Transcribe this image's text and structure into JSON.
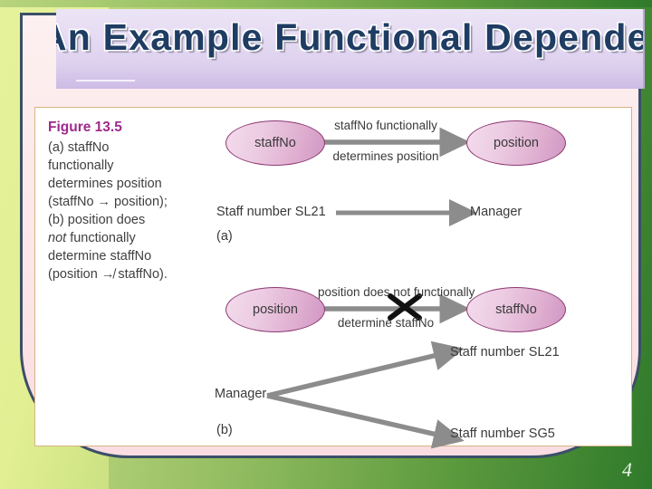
{
  "slide": {
    "title": "An Example Functional Dependency",
    "page_number": "4",
    "accent_title_color": "#1f3c63",
    "figure_title_color": "#9e2a8c",
    "arrow_color": "#8c8c8c",
    "ellipse_border_color": "#8e3a74",
    "figure_border_color": "#d8b383",
    "background_green": "#2f7a2b",
    "left_wash_color": "#e6f29a"
  },
  "figure": {
    "caption": {
      "title": "Figure 13.5",
      "lines": [
        "(a) staffNo",
        "functionally",
        "determines position",
        "(staffNo → position);",
        "(b) position does",
        "not functionally",
        "determine staffNo",
        "(position ↛ staffNo)."
      ],
      "italic_line_index": 5,
      "italic_word": "not"
    },
    "part_a": {
      "label": "(a)",
      "source_node": "staffNo",
      "target_node": "position",
      "arrow_caption_top": "staffNo functionally",
      "arrow_caption_bottom": "determines position",
      "instance_source": "Staff number SL21",
      "instance_target": "Manager"
    },
    "part_b": {
      "label": "(b)",
      "source_node": "position",
      "target_node": "staffNo",
      "arrow_caption_top": "position does not functionally",
      "arrow_caption_bottom": "determine staffNo",
      "negation_mark": "✕",
      "instance_source": "Manager",
      "instance_target_1": "Staff number SL21",
      "instance_target_2": "Staff number SG5"
    }
  }
}
